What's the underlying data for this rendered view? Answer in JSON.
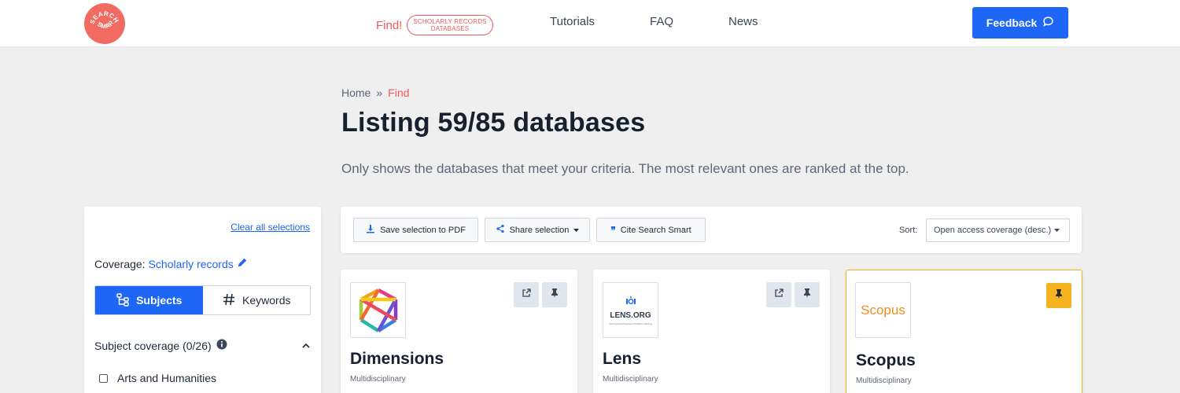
{
  "header": {
    "logo_text": "SEARCH SMART",
    "nav": {
      "find_label": "Find!",
      "find_pill_line1": "SCHOLARLY RECORDS",
      "find_pill_line2": "DATABASES",
      "tutorials": "Tutorials",
      "faq": "FAQ",
      "news": "News"
    },
    "feedback_label": "Feedback"
  },
  "breadcrumb": {
    "home": "Home",
    "separator": "»",
    "current": "Find"
  },
  "page": {
    "title": "Listing 59/85 databases",
    "subtitle": "Only shows the databases that meet your criteria. The most relevant ones are ranked at the top."
  },
  "sidebar": {
    "clear_all": "Clear all selections",
    "coverage_label": "Coverage:",
    "coverage_value": "Scholarly records",
    "tabs": {
      "subjects": "Subjects",
      "keywords": "Keywords"
    },
    "subject_coverage_label": "Subject coverage (0/26)",
    "subjects": [
      "Arts and Humanities"
    ]
  },
  "toolbar": {
    "save_pdf": "Save selection to PDF",
    "share": "Share selection",
    "cite": "Cite Search Smart",
    "sort_label": "Sort:",
    "sort_value": "Open access coverage (desc.)"
  },
  "cards": [
    {
      "title": "Dimensions",
      "category": "Multidisciplinary",
      "pinned": false
    },
    {
      "title": "Lens",
      "category": "Multidisciplinary",
      "pinned": false,
      "logo_text": "LENS.ORG",
      "logo_tagline": "Serving the Progress of Problem Solving"
    },
    {
      "title": "Scopus",
      "category": "Multidisciplinary",
      "pinned": true,
      "logo_text": "Scopus"
    }
  ],
  "colors": {
    "accent_blue": "#1e66f5",
    "brand_coral": "#f26b63",
    "find_red": "#ee5a5a",
    "pin_active": "#f5b320"
  }
}
